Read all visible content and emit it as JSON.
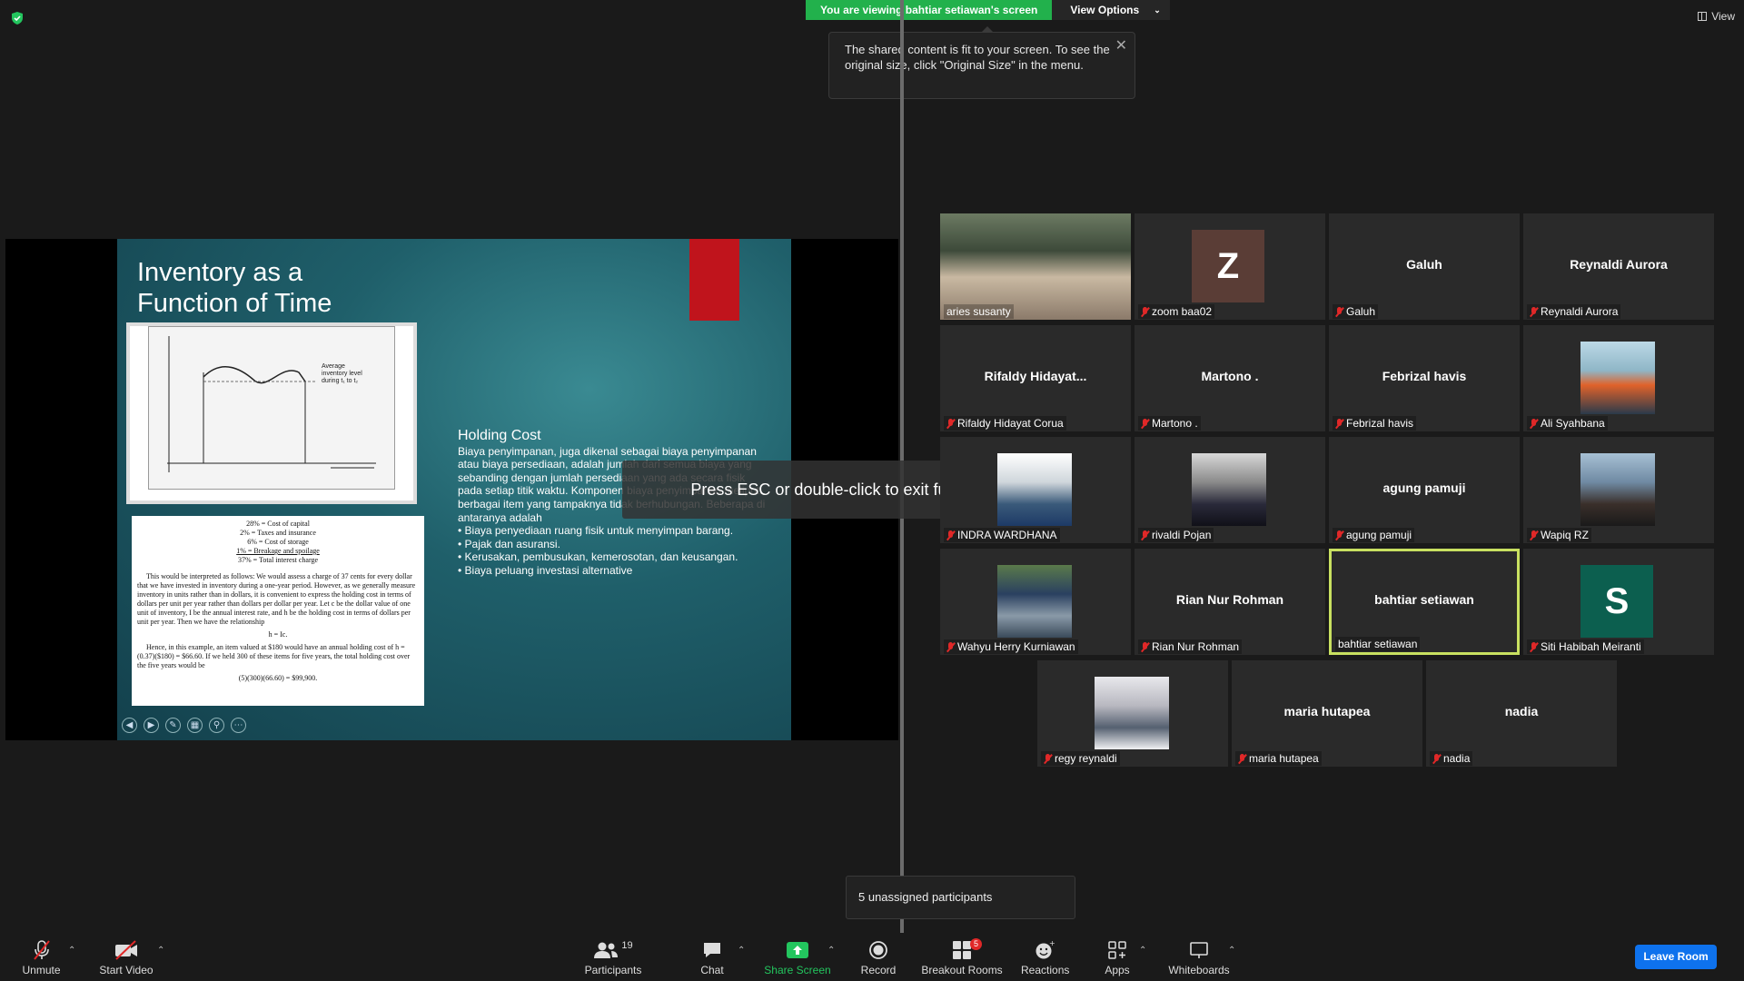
{
  "top": {
    "sharing_banner": "You are viewing bahtiar setiawan's screen",
    "view_options": "View Options",
    "view_button": "View"
  },
  "tooltip": {
    "text": "The shared content is fit to your screen. To see the original size, click \"Original Size\" in the menu."
  },
  "toast": {
    "esc": "Press ESC or double-click to exit full screen mode"
  },
  "slide": {
    "title_line1": "Inventory as a",
    "title_line2": "Function of Time",
    "graph_legend": "Average inventory level during t₁ to t₂",
    "cost_lines": [
      "28% = Cost of capital",
      "2% = Taxes and insurance",
      "6% = Cost of storage",
      "1% = Breakage and spoilage",
      "37% = Total interest charge"
    ],
    "paragraph1": "This would be interpreted as follows: We would assess a charge of 37 cents for every dollar that we have invested in inventory during a one-year period. However, as we generally measure inventory in units rather than in dollars, it is convenient to express the holding cost in terms of dollars per unit per year rather than dollars per dollar per year. Let c be the dollar value of one unit of inventory, I be the annual interest rate, and h be the holding cost in terms of dollars per unit per year. Then we have the relationship",
    "formula": "h = Ic.",
    "paragraph2": "Hence, in this example, an item valued at $180 would have an annual holding cost of h = (0.37)($180) = $66.60. If we held 300 of these items for five years, the total holding cost over the five years would be",
    "result": "(5)(300)(66.60) = $99,900.",
    "holding_heading": "Holding Cost",
    "holding_body": "Biaya penyimpanan, juga dikenal sebagai biaya penyimpanan atau biaya persediaan, adalah jumlah dari semua biaya yang sebanding dengan jumlah persediaan yang ada secara fisik pada setiap titik waktu. Komponen biaya penyimpanan meliputi berbagai item yang tampaknya tidak berhubungan. Beberapa di antaranya adalah",
    "bullets": [
      "• Biaya penyediaan ruang fisik untuk menyimpan barang.",
      "• Pajak dan asuransi.",
      "• Kerusakan, pembusukan, kemerosotan, dan keusangan.",
      "• Biaya peluang investasi alternative"
    ]
  },
  "participants": [
    {
      "label": "aries susanty",
      "display": "",
      "muted": false
    },
    {
      "label": "zoom baa02",
      "display": "Z",
      "muted": true
    },
    {
      "label": "Galuh",
      "display": "Galuh",
      "muted": true
    },
    {
      "label": "Reynaldi Aurora",
      "display": "Reynaldi Aurora",
      "muted": true
    },
    {
      "label": "Rifaldy Hidayat Corua",
      "display": "Rifaldy  Hidayat...",
      "muted": true
    },
    {
      "label": "Martono .",
      "display": "Martono .",
      "muted": true
    },
    {
      "label": "Febrizal havis",
      "display": "Febrizal havis",
      "muted": true
    },
    {
      "label": "Ali Syahbana",
      "display": "",
      "muted": true
    },
    {
      "label": "INDRA WARDHANA",
      "display": "",
      "muted": true
    },
    {
      "label": "rivaldi Pojan",
      "display": "",
      "muted": true
    },
    {
      "label": "agung pamuji",
      "display": "agung pamuji",
      "muted": true
    },
    {
      "label": "Wapiq RZ",
      "display": "",
      "muted": true
    },
    {
      "label": "Wahyu Herry Kurniawan",
      "display": "",
      "muted": true
    },
    {
      "label": "Rian Nur Rohman",
      "display": "Rian Nur Rohman",
      "muted": true
    },
    {
      "label": "bahtiar setiawan",
      "display": "bahtiar setiawan",
      "muted": false
    },
    {
      "label": "Siti Habibah Meiranti",
      "display": "S",
      "muted": true
    },
    {
      "label": "regy reynaldi",
      "display": "",
      "muted": true
    },
    {
      "label": "maria hutapea",
      "display": "maria hutapea",
      "muted": true
    },
    {
      "label": "nadia",
      "display": "nadia",
      "muted": true
    }
  ],
  "unassigned": "5 unassigned participants",
  "toolbar": {
    "unmute": "Unmute",
    "start_video": "Start Video",
    "participants": "Participants",
    "participants_count": "19",
    "chat": "Chat",
    "share_screen": "Share Screen",
    "record": "Record",
    "breakout_rooms": "Breakout Rooms",
    "breakout_badge": "5",
    "reactions": "Reactions",
    "apps": "Apps",
    "whiteboards": "Whiteboards",
    "leave": "Leave Room"
  },
  "colors": {
    "share_green": "#22b14c",
    "leave_blue": "#0e72ed",
    "muted_red": "#e02828",
    "speaker_border": "#c8e060"
  }
}
